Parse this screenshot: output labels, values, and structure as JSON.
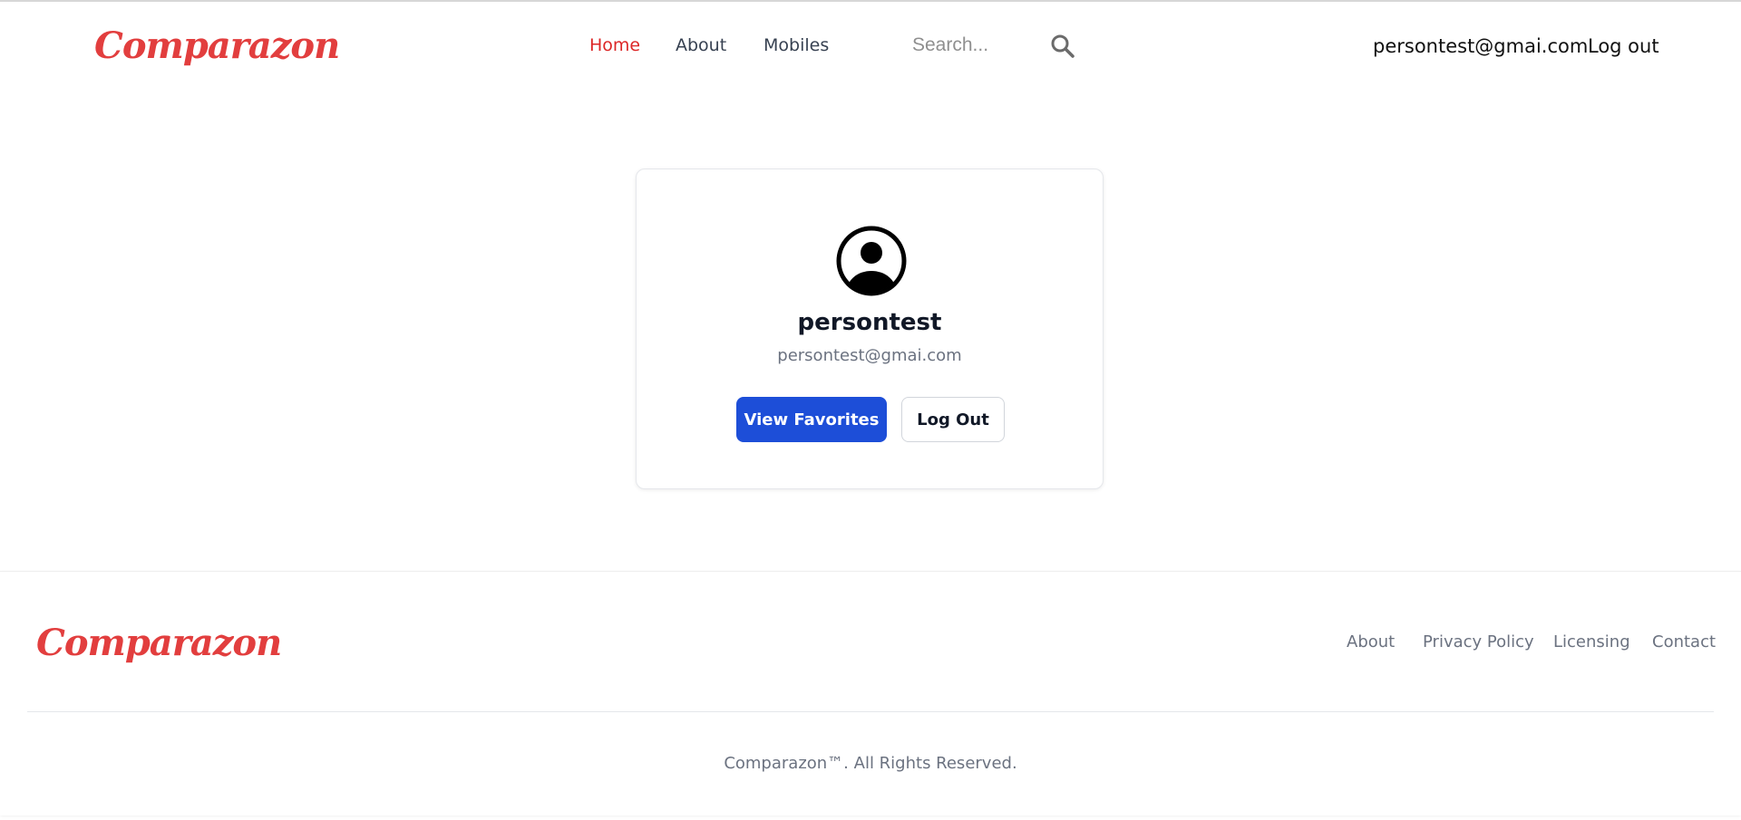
{
  "brand": {
    "name": "Comparazon",
    "color": "#e23e3e"
  },
  "header": {
    "nav": [
      {
        "label": "Home",
        "active": true
      },
      {
        "label": "About",
        "active": false
      },
      {
        "label": "Mobiles",
        "active": false
      }
    ],
    "search": {
      "placeholder": "Search...",
      "value": "",
      "icon": "search-icon"
    },
    "user_email": "persontest@gmai.com",
    "logout_label": "Log out"
  },
  "profile": {
    "avatar_icon": "user-circle-icon",
    "username": "persontest",
    "email": "persontest@gmai.com",
    "view_favorites_label": "View Favorites",
    "logout_label": "Log Out",
    "primary_color": "#1d4ed8"
  },
  "footer": {
    "links": [
      "About",
      "Privacy Policy",
      "Licensing",
      "Contact"
    ],
    "copyright": "Comparazon™. All Rights Reserved."
  }
}
